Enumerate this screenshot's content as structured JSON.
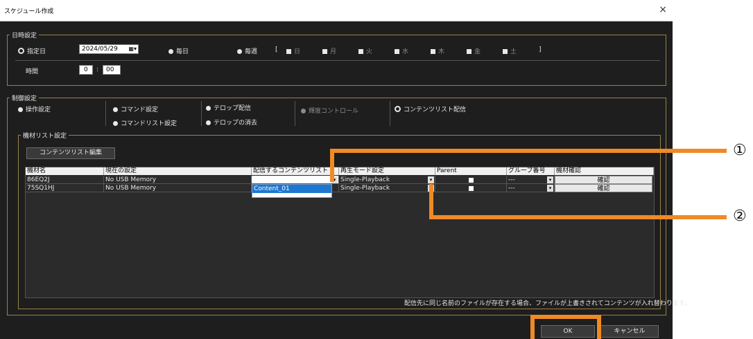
{
  "window": {
    "title": "スケジュール作成",
    "close": "×"
  },
  "datetime": {
    "group_title": "日時設定",
    "specified_day": "指定日",
    "date_value": "2024/05/29",
    "daily": "毎日",
    "weekly": "毎週",
    "bracket_open": "[",
    "bracket_close": "]",
    "weekdays": [
      "日",
      "月",
      "火",
      "水",
      "木",
      "金",
      "土"
    ],
    "time_label": "時間",
    "hour": "0",
    "colon": ":",
    "minute": "00"
  },
  "control": {
    "group_title": "制御設定",
    "operation_settings": "操作設定",
    "command_settings": "コマンド設定",
    "command_list_settings": "コマンドリスト設定",
    "telop_delivery": "テロップ配信",
    "telop_delete": "テロップの消去",
    "brightness_control": "輝度コントロール",
    "content_list_delivery": "コンテンツリスト配信"
  },
  "device_list": {
    "group_title": "機材リスト設定",
    "edit_button": "コンテンツリスト編集",
    "columns": [
      "機材名",
      "現在の設定",
      "配信するコンテンツリスト",
      "再生モード設定",
      "Parent",
      "グループ番号",
      "機材確認"
    ],
    "rows": [
      {
        "name": "86EQ2J",
        "current": "No USB Memory",
        "content": "",
        "mode": "Single-Playback",
        "group": "---",
        "confirm": "確認"
      },
      {
        "name": "75SQ1HJ",
        "current": "No USB Memory",
        "content": "",
        "mode": "Single-Playback",
        "group": "---",
        "confirm": "確認"
      }
    ],
    "dropdown_option": "Content_01",
    "footer_note": "配信先に同じ名前のファイルが存在する場合、ファイルが上書きされてコンテンツが入れ替わります。"
  },
  "footer": {
    "ok": "OK",
    "cancel": "キャンセル"
  },
  "callouts": {
    "one": "①",
    "two": "②"
  },
  "colors": {
    "highlight": "#f08a24",
    "group_border": "#9a8248",
    "background": "#1e1e1e"
  }
}
